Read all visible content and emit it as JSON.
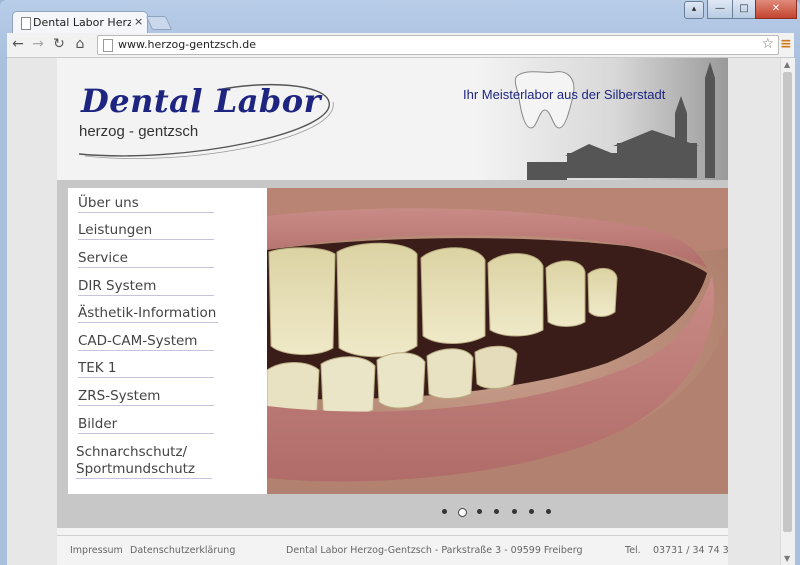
{
  "browser": {
    "tab_title": "Dental Labor Herzog",
    "tab_close": "×",
    "url": "www.herzog-gentzsch.de",
    "window_controls": {
      "profile": "▴",
      "minimize": "—",
      "maximize": "□",
      "close": "✕"
    },
    "nav_icons": {
      "back": "←",
      "forward": "→",
      "reload": "↻",
      "home": "⌂",
      "star": "☆",
      "menu": "≡"
    }
  },
  "site": {
    "logo_title": "Dental Labor",
    "logo_subtitle": "herzog - gentzsch",
    "tagline": "Ihr Meisterlabor aus der Silberstadt"
  },
  "nav": {
    "items": [
      {
        "label": "Über uns"
      },
      {
        "label": "Leistungen"
      },
      {
        "label": "Service"
      },
      {
        "label": "DIR System"
      },
      {
        "label": "Ästhetik-Information"
      },
      {
        "label": "CAD-CAM-System"
      },
      {
        "label": "TEK 1"
      },
      {
        "label": "ZRS-System"
      },
      {
        "label": "Bilder"
      },
      {
        "label": "Schnarchschutz/"
      }
    ],
    "last_line2": "Sportmundschutz"
  },
  "slider": {
    "count": 7,
    "active": 1
  },
  "footer": {
    "impressum": "Impressum",
    "datenschutz": "Datenschutzerklärung",
    "address": "Dental Labor Herzog-Gentzsch - Parkstraße 3 - 09599 Freiberg",
    "tel_label": "Tel.",
    "tel_value": "03731 / 34 74 3"
  },
  "colors": {
    "brand": "#1d2580",
    "frame": "#a9c0de",
    "menu_icon": "#d07a1a"
  }
}
